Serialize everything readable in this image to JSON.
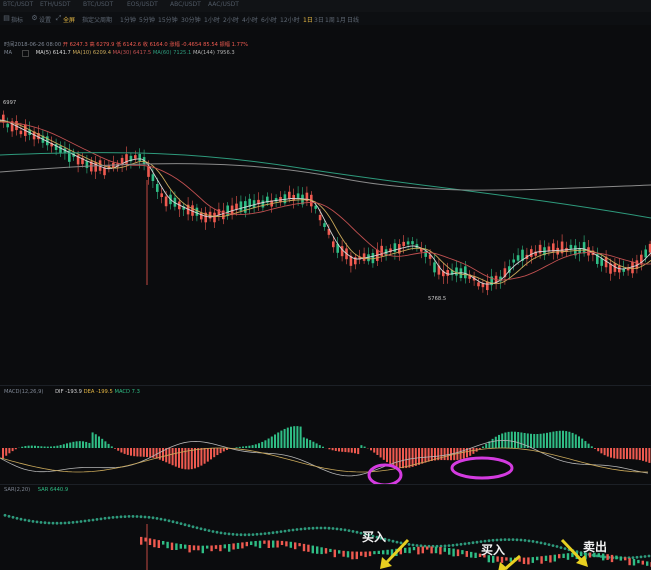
{
  "top_tabs": [
    "BTC/USDT",
    "ETH/USDT",
    "BTC/USDT",
    "EOS/USDT",
    "ABC/USDT",
    "AAC/USDT"
  ],
  "toolbar": {
    "items": [
      "指标",
      "设置",
      "全屏"
    ],
    "tool_label": "指定父周期",
    "timeframes": [
      "1分钟",
      "5分钟",
      "15分钟",
      "30分钟",
      "1小时",
      "2小时",
      "4小时",
      "6小时",
      "12小时",
      "1日",
      "3日",
      "1周",
      "1月",
      "日线"
    ],
    "active_timeframe_index": 9
  },
  "info_line": {
    "time": "时间2018-06-26 08:00",
    "open": "开 6247.3",
    "high": "高 6279.9",
    "low": "低 6142.6",
    "close": "收 6164.0",
    "change": "涨幅 -0.4654 85.54",
    "amplitude": "振幅 1.77%"
  },
  "ma_line": {
    "label": "MA",
    "ma5": "MA(5) 6141.7",
    "ma10": "MA(10) 6209.4",
    "ma30": "MA(30) 6417.5",
    "ma60": "MA(60) 7125.1",
    "ma144": "MA(144) 7956.3"
  },
  "price_labels": {
    "high": "6997",
    "low": "5768.5"
  },
  "macd": {
    "label": "MACD(12,26,9)",
    "dif": "DIF -193.9",
    "dea": "DEA -199.5",
    "macd": "MACD 7.3"
  },
  "sar": {
    "label": "SAR(2,20)",
    "value": "SAR 6440.9"
  },
  "annotations": {
    "buy1": "买入",
    "buy2": "买入",
    "sell": "卖出"
  },
  "colors": {
    "bg": "#0b0c0e",
    "up": "#2fbd85",
    "down": "#ef5a50",
    "ma5": "#d6d6d6",
    "ma10": "#c9a85a",
    "ma30": "#c05050",
    "ma60": "#2e9a7c",
    "ma144": "#8a8a8a",
    "highlight": "#d43be0",
    "arrow": "#e8d020",
    "accent": "#e5b743"
  }
}
